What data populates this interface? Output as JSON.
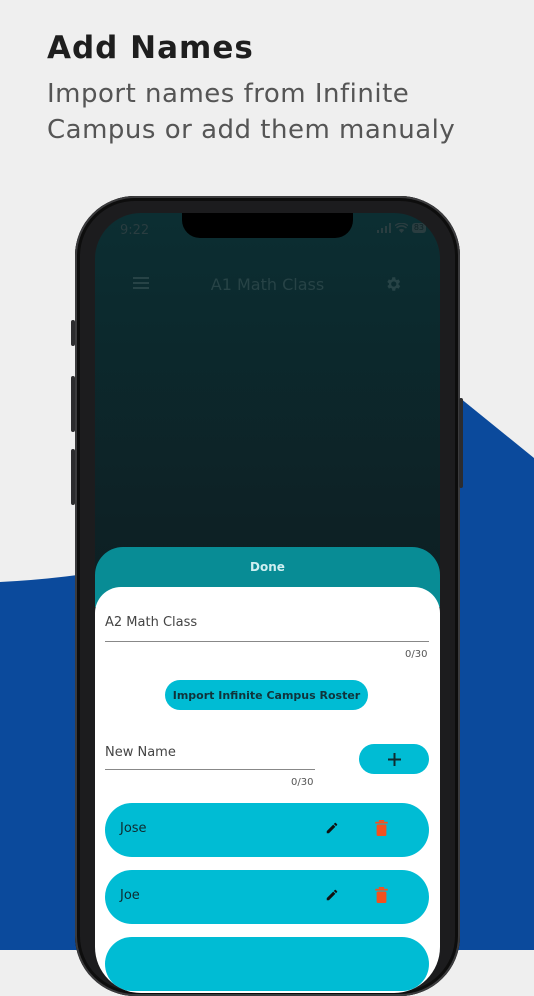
{
  "promo": {
    "headline": "Add Names",
    "subhead": "Import names from Infinite Campus or add them manualy"
  },
  "status_bar": {
    "time": "9:22",
    "battery": "83"
  },
  "app_bar": {
    "title": "A1 Math Class",
    "menu_icon": "hamburger-menu-icon",
    "settings_icon": "gear-icon"
  },
  "sheet": {
    "done_label": "Done",
    "class_name_value": "A2 Math Class",
    "class_name_counter": "0/30",
    "import_button_label": "Import Infinite Campus Roster",
    "new_name_placeholder": "New Name",
    "new_name_counter": "0/30",
    "add_icon": "plus-icon",
    "names": [
      {
        "name": "Jose"
      },
      {
        "name": "Joe"
      },
      {
        "name": ""
      }
    ]
  },
  "colors": {
    "accent": "#00bcd4",
    "sheet_header": "#088c95",
    "delete": "#f4511e",
    "wave_blue": "#0b4a9c"
  }
}
